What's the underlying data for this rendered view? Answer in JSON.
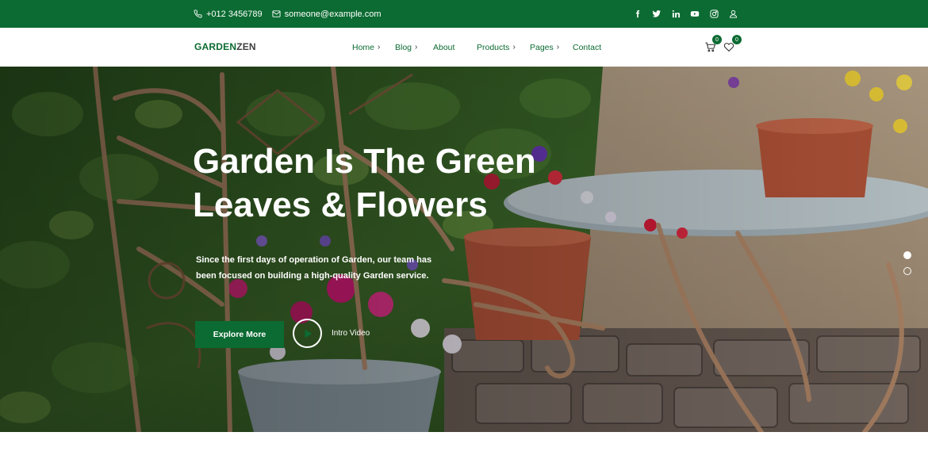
{
  "topbar": {
    "phone": "+012 3456789",
    "email": "someone@example.com",
    "social_icons": [
      "facebook-icon",
      "twitter-icon",
      "linkedin-icon",
      "youtube-icon",
      "instagram-icon",
      "user-icon"
    ]
  },
  "header": {
    "logo_part1": "GARDEN",
    "logo_part2": "ZEN",
    "nav": [
      {
        "label": "Home",
        "has_chevron": true
      },
      {
        "label": "Blog",
        "has_chevron": true
      },
      {
        "label": "About",
        "has_chevron": false
      },
      {
        "label": "Products",
        "has_chevron": true
      },
      {
        "label": "Pages",
        "has_chevron": true
      },
      {
        "label": "Contact",
        "has_chevron": false
      }
    ],
    "cart_count": "0",
    "wishlist_count": "0"
  },
  "hero": {
    "title_line1": "Garden Is The Green",
    "title_line2": "Leaves & Flowers",
    "subtitle_line1": "Since the first days of operation of Garden, our team has",
    "subtitle_line2": "been focused on building a high-quality Garden service.",
    "cta_label": "Explore More",
    "video_label": "Intro Video",
    "slides": 2,
    "active_slide": 1
  },
  "colors": {
    "brand_green": "#0b6b32",
    "white": "#ffffff"
  }
}
